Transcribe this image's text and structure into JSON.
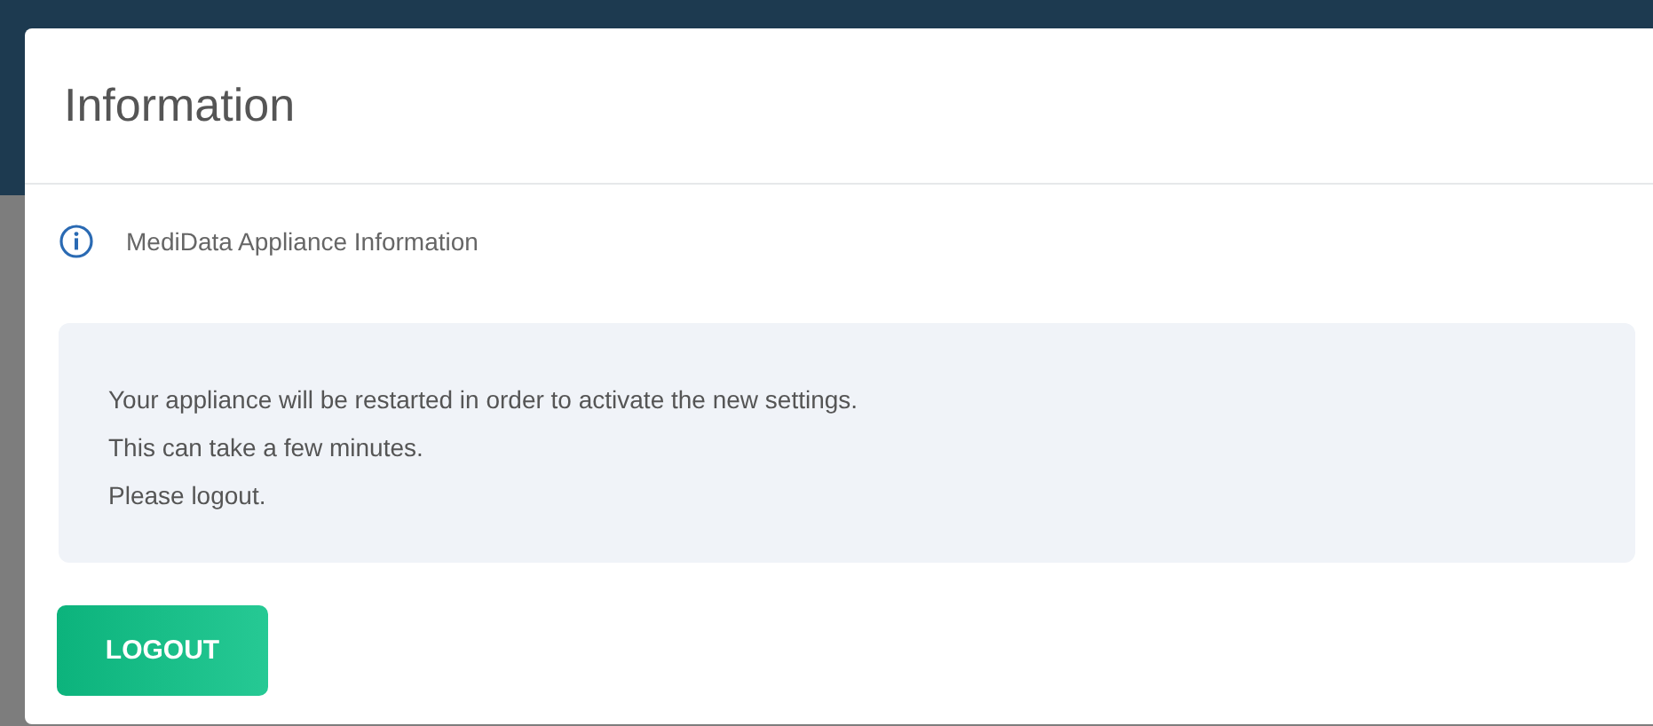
{
  "dialog": {
    "title": "Information",
    "subtitle": "MediData Appliance Information",
    "message_lines": [
      "Your appliance will be restarted in order to activate the new settings.",
      "This can take a few minutes.",
      "Please logout."
    ],
    "buttons": [
      {
        "label": "LOGOUT"
      }
    ]
  }
}
